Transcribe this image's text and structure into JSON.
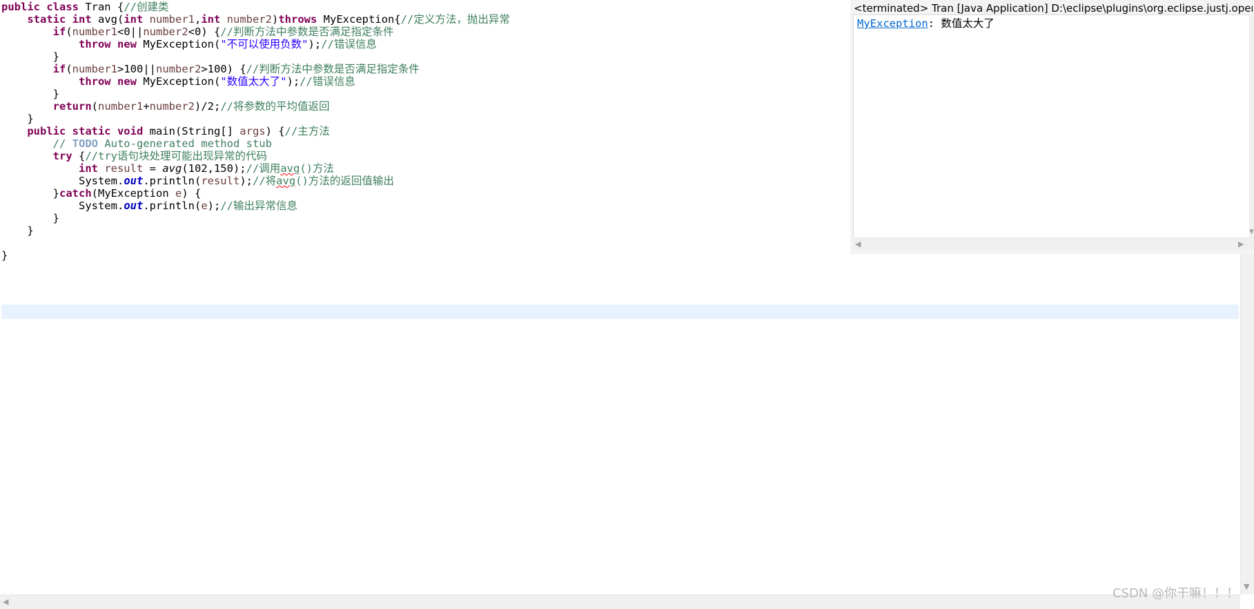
{
  "editor": {
    "lines": {
      "l1": {
        "kw1": "public class",
        "t1": " Tran {",
        "c1": "//创建类"
      },
      "l2": {
        "kw1": "static int",
        "t1": " avg(",
        "kw2": "int",
        "v1": " number1",
        "t2": ",",
        "kw3": "int",
        "v2": " number2",
        "t3": ")",
        "kw4": "throws",
        "t4": " MyException{",
        "c1": "//定义方法，抛出异常"
      },
      "l3": {
        "kw1": "if",
        "t1": "(",
        "v1": "number1",
        "t2": "<0||",
        "v2": "number2",
        "t3": "<0) {",
        "c1": "//判断方法中参数是否满足指定条件"
      },
      "l4": {
        "kw1": "throw new",
        "t1": " MyException(",
        "s1": "\"不可以使用负数\"",
        "t2": ");",
        "c1": "//错误信息"
      },
      "l5": {
        "t1": "}"
      },
      "l6": {
        "kw1": "if",
        "t1": "(",
        "v1": "number1",
        "t2": ">100||",
        "v2": "number2",
        "t3": ">100) {",
        "c1": "//判断方法中参数是否满足指定条件"
      },
      "l7": {
        "kw1": "throw new",
        "t1": " MyException(",
        "s1": "\"数值太大了\"",
        "t2": ");",
        "c1": "//错误信息"
      },
      "l8": {
        "t1": "}"
      },
      "l9": {
        "kw1": "return",
        "t1": "(",
        "v1": "number1",
        "t2": "+",
        "v2": "number2",
        "t3": ")/2;",
        "c1": "//将参数的平均值返回"
      },
      "l10": {
        "t1": "}"
      },
      "l11": {
        "kw1": "public static void",
        "t1": " main(String[] ",
        "v1": "args",
        "t2": ") {",
        "c1": "//主方法"
      },
      "l12": {
        "c1": "// ",
        "todo": "TODO",
        "c2": " Auto-generated method stub"
      },
      "l13": {
        "kw1": "try",
        "t1": " {",
        "c1": "//try语句块处理可能出现异常的代码"
      },
      "l14": {
        "kw1": "int",
        "v1": " result",
        "t1": " = ",
        "m1": "avg",
        "t2": "(102,150);",
        "c1": "//调用",
        "c2": "avg",
        "c3": "()方法"
      },
      "l15": {
        "t1": "System.",
        "f1": "out",
        "t2": ".println(",
        "v1": "result",
        "t3": ");",
        "c1": "//将",
        "c2": "avg",
        "c3": "()方法的返回值输出"
      },
      "l16": {
        "t1": "}",
        "kw1": "catch",
        "t2": "(MyException ",
        "v1": "e",
        "t3": ") {"
      },
      "l17": {
        "t1": "System.",
        "f1": "out",
        "t2": ".println(",
        "v1": "e",
        "t3": ");",
        "c1": "//输出异常信息"
      },
      "l18": {
        "t1": "}"
      },
      "l19": {
        "t1": "}"
      },
      "l21": {
        "t1": "}"
      }
    }
  },
  "console": {
    "header": "<terminated> Tran [Java Application] D:\\eclipse\\plugins\\org.eclipse.justj.openjdk",
    "output_link": "MyException",
    "output_text": ": 数值太大了"
  },
  "watermark": "CSDN @你干嘛！！！",
  "icons": {
    "scroll_left": "◀",
    "scroll_right": "▶",
    "scroll_up": "▲",
    "scroll_down": "▼"
  },
  "colors": {
    "keyword": "#7f0055",
    "comment": "#3f7f5f",
    "string": "#2a00ff",
    "local_variable": "#6a3e3e",
    "static_field": "#0000c0",
    "current_line": "#e8f2fe",
    "link": "#0066cc"
  }
}
